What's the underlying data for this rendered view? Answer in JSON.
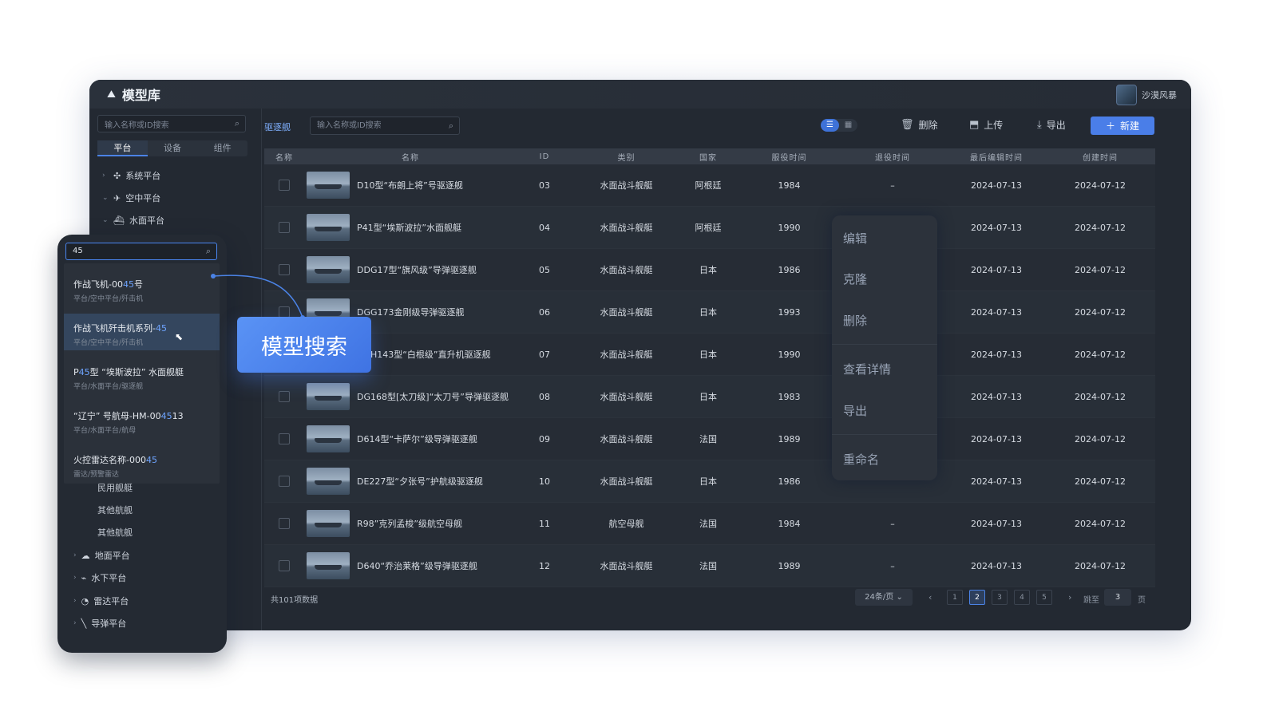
{
  "app": {
    "title": "模型库",
    "user_name": "沙漠风暴"
  },
  "sidebar": {
    "search_placeholder": "输入名称或ID搜索",
    "tabs": [
      {
        "label": "平台"
      },
      {
        "label": "设备"
      },
      {
        "label": "组件"
      }
    ],
    "tree": [
      {
        "label": "系统平台"
      },
      {
        "label": "空中平台"
      },
      {
        "label": "水面平台"
      }
    ]
  },
  "toolbar": {
    "category": "驱逐舰",
    "search_placeholder": "输入名称或ID搜索",
    "delete_label": "删除",
    "upload_label": "上传",
    "export_label": "导出",
    "new_label": "新建"
  },
  "table": {
    "headers": [
      "名称",
      "名称",
      "ID",
      "类别",
      "国家",
      "服役时间",
      "退役时间",
      "最后编辑时间",
      "创建时间"
    ],
    "rows": [
      {
        "name": "D10型“布朗上将”号驱逐舰",
        "id": "03",
        "type": "水面战斗舰艇",
        "country": "阿根廷",
        "service": "1984",
        "retire": "–",
        "edited": "2024-07-13",
        "created": "2024-07-12"
      },
      {
        "name": "P41型“埃斯波拉”水面舰艇",
        "id": "04",
        "type": "水面战斗舰艇",
        "country": "阿根廷",
        "service": "1990",
        "retire": "",
        "edited": "2024-07-13",
        "created": "2024-07-12"
      },
      {
        "name": "DDG17型“旗风级”导弹驱逐舰",
        "id": "05",
        "type": "水面战斗舰艇",
        "country": "日本",
        "service": "1986",
        "retire": "",
        "edited": "2024-07-13",
        "created": "2024-07-12"
      },
      {
        "name": "DGG173金刚级导弹驱逐舰",
        "id": "06",
        "type": "水面战斗舰艇",
        "country": "日本",
        "service": "1993",
        "retire": "",
        "edited": "2024-07-13",
        "created": "2024-07-12"
      },
      {
        "name": "DDH143型“白根级”直升机驱逐舰",
        "id": "07",
        "type": "水面战斗舰艇",
        "country": "日本",
        "service": "1990",
        "retire": "",
        "edited": "2024-07-13",
        "created": "2024-07-12"
      },
      {
        "name": "DG168型[太刀级]“太刀号”导弹驱逐舰",
        "id": "08",
        "type": "水面战斗舰艇",
        "country": "日本",
        "service": "1983",
        "retire": "",
        "edited": "2024-07-13",
        "created": "2024-07-12"
      },
      {
        "name": "D614型“卡萨尔”级导弹驱逐舰",
        "id": "09",
        "type": "水面战斗舰艇",
        "country": "法国",
        "service": "1989",
        "retire": "",
        "edited": "2024-07-13",
        "created": "2024-07-12"
      },
      {
        "name": "DE227型“夕张号”护航级驱逐舰",
        "id": "10",
        "type": "水面战斗舰艇",
        "country": "日本",
        "service": "1986",
        "retire": "",
        "edited": "2024-07-13",
        "created": "2024-07-12"
      },
      {
        "name": "R98”克列孟梭”级航空母舰",
        "id": "11",
        "type": "航空母舰",
        "country": "法国",
        "service": "1984",
        "retire": "–",
        "edited": "2024-07-13",
        "created": "2024-07-12"
      },
      {
        "name": "D640“乔治莱格”级导弹驱逐舰",
        "id": "12",
        "type": "水面战斗舰艇",
        "country": "法国",
        "service": "1989",
        "retire": "–",
        "edited": "2024-07-13",
        "created": "2024-07-12"
      }
    ]
  },
  "footer": {
    "total": "共101项数据",
    "page_size": "24条/页",
    "pages": [
      "1",
      "2",
      "3",
      "4",
      "5"
    ],
    "current_page": "2",
    "jump_label": "跳至",
    "jump_value": "3",
    "page_unit": "页"
  },
  "context_menu": [
    "编辑",
    "克隆",
    "删除",
    "查看详情",
    "导出",
    "重命名"
  ],
  "float_panel": {
    "search_value": "45",
    "results": [
      {
        "title_pre": "作战飞机-00",
        "title_hl": "45",
        "title_post": "号",
        "path": "平台/空中平台/歼击机"
      },
      {
        "title_pre": "作战飞机歼击机系列-",
        "title_hl": "45",
        "title_post": "",
        "path": "平台/空中平台/歼击机"
      },
      {
        "title_pre": "P",
        "title_hl": "45",
        "title_post": "型 “埃斯波拉” 水面舰艇",
        "path": "平台/水面平台/驱逐舰"
      },
      {
        "title_pre": "“辽宁” 号航母-HM-00",
        "title_hl": "45",
        "title_post": "13",
        "path": "平台/水面平台/航母"
      },
      {
        "title_pre": "火控雷达名称-000",
        "title_hl": "45",
        "title_post": "",
        "path": "雷达/预警雷达"
      }
    ],
    "sub_items": [
      "民用舰艇",
      "其他航舰",
      "其他航舰"
    ],
    "tree": [
      {
        "label": "地面平台"
      },
      {
        "label": "水下平台"
      },
      {
        "label": "雷达平台"
      },
      {
        "label": "导弹平台"
      }
    ]
  },
  "callout": "模型搜索",
  "colors": {
    "accent": "#4a7ee8",
    "highlight": "#6ea4ff",
    "window_bg": "#232932"
  }
}
